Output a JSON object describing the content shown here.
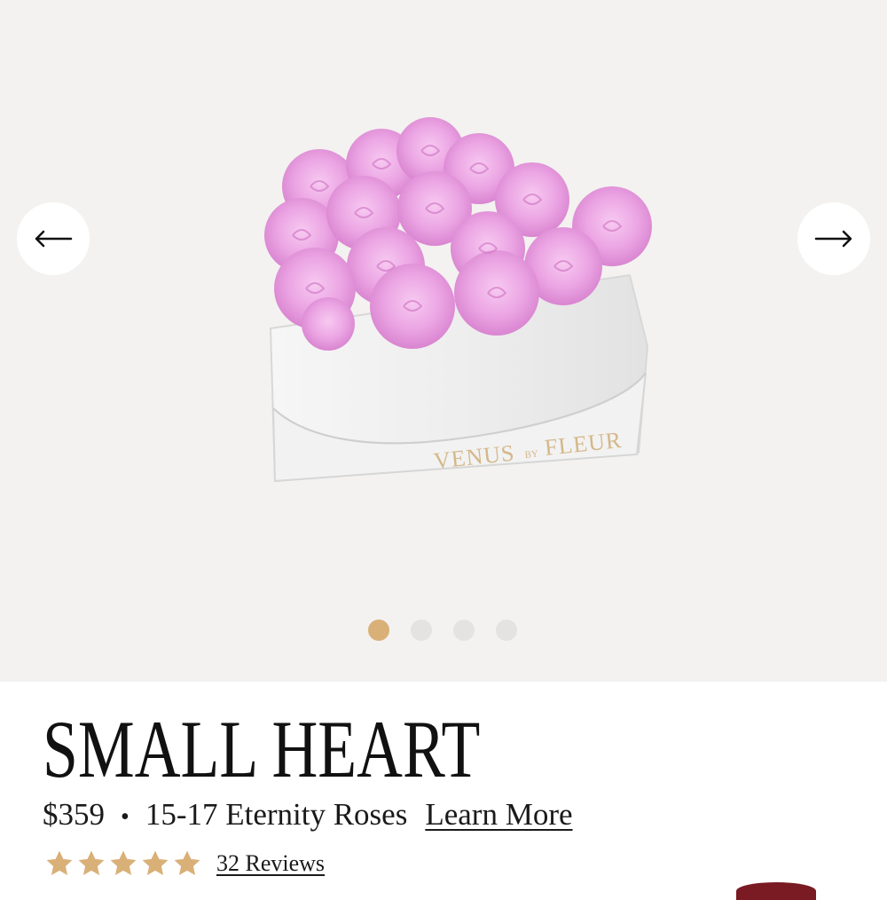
{
  "gallery": {
    "brand_mark": {
      "left": "VENUS",
      "middle": "BY",
      "right": "FLEUR"
    },
    "prev_icon": "arrow-left-icon",
    "next_icon": "arrow-right-icon",
    "slide_count": 4,
    "active_slide": 1
  },
  "product": {
    "title": "SMALL HEART",
    "price": "$359",
    "separator": "•",
    "description": "15-17 Eternity Roses",
    "learn_more_label": "Learn More",
    "rating": 5,
    "rating_max": 5,
    "reviews_label": "32 Reviews"
  },
  "colors": {
    "gallery_bg": "#f3f2f0",
    "accent_gold": "#d9b077",
    "dot_inactive": "#e4e3e1",
    "rose_pink": "#f0a6e6",
    "star_gold": "#d9b077"
  }
}
